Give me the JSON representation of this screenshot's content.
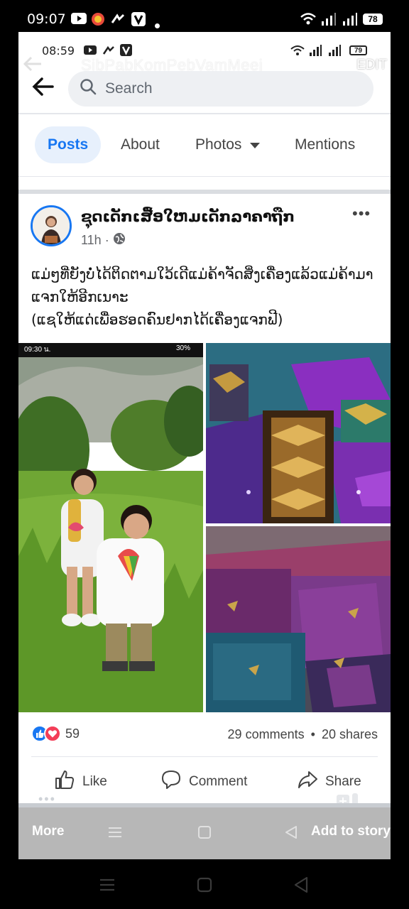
{
  "status_outer": {
    "time": "09:07",
    "battery": "78"
  },
  "status_inner": {
    "time": "08:59",
    "battery": "79"
  },
  "overlay": {
    "title": "SibPabKomPebVamMeej",
    "edit_label": "EDIT"
  },
  "search": {
    "placeholder": "Search"
  },
  "tabs": [
    {
      "label": "Posts",
      "active": true
    },
    {
      "label": "About",
      "active": false
    },
    {
      "label": "Photos",
      "active": false
    },
    {
      "label": "Mentions",
      "active": false
    }
  ],
  "post": {
    "author": "ຊຸດເດັກເສື້ອໃຫມເດັກລາຄາຖືກ",
    "time_ago": "11h",
    "meta_separator": "·",
    "text": "ແມ່ໆທີ່ຍັງບໍ່ໄດ້ຕິດຕາມໃວ້ເດີແມ່ຄ້າຈັດສິ່ງເຄື່ອງແລ້ວແມ່ຄ້າມາແຈກໃຫ້ອີກເນາະ\n (ແຊໃຫ້ແດ່ເພື່ອຮອດຄົນຢາກໄດ້ເຄື່ອງແຈກຟີ)",
    "photo_status_time": "09:30 น.",
    "photo_status_battery": "30%",
    "reaction_count": "59",
    "comments": "29 comments",
    "shares": "20 shares",
    "counts_separator": "•"
  },
  "actions": {
    "like": "Like",
    "comment": "Comment",
    "share": "Share"
  },
  "bottom": {
    "more": "More",
    "add_to_story": "Add to story"
  },
  "colors": {
    "facebook_blue": "#1877f2",
    "love_red": "#f33e58"
  }
}
